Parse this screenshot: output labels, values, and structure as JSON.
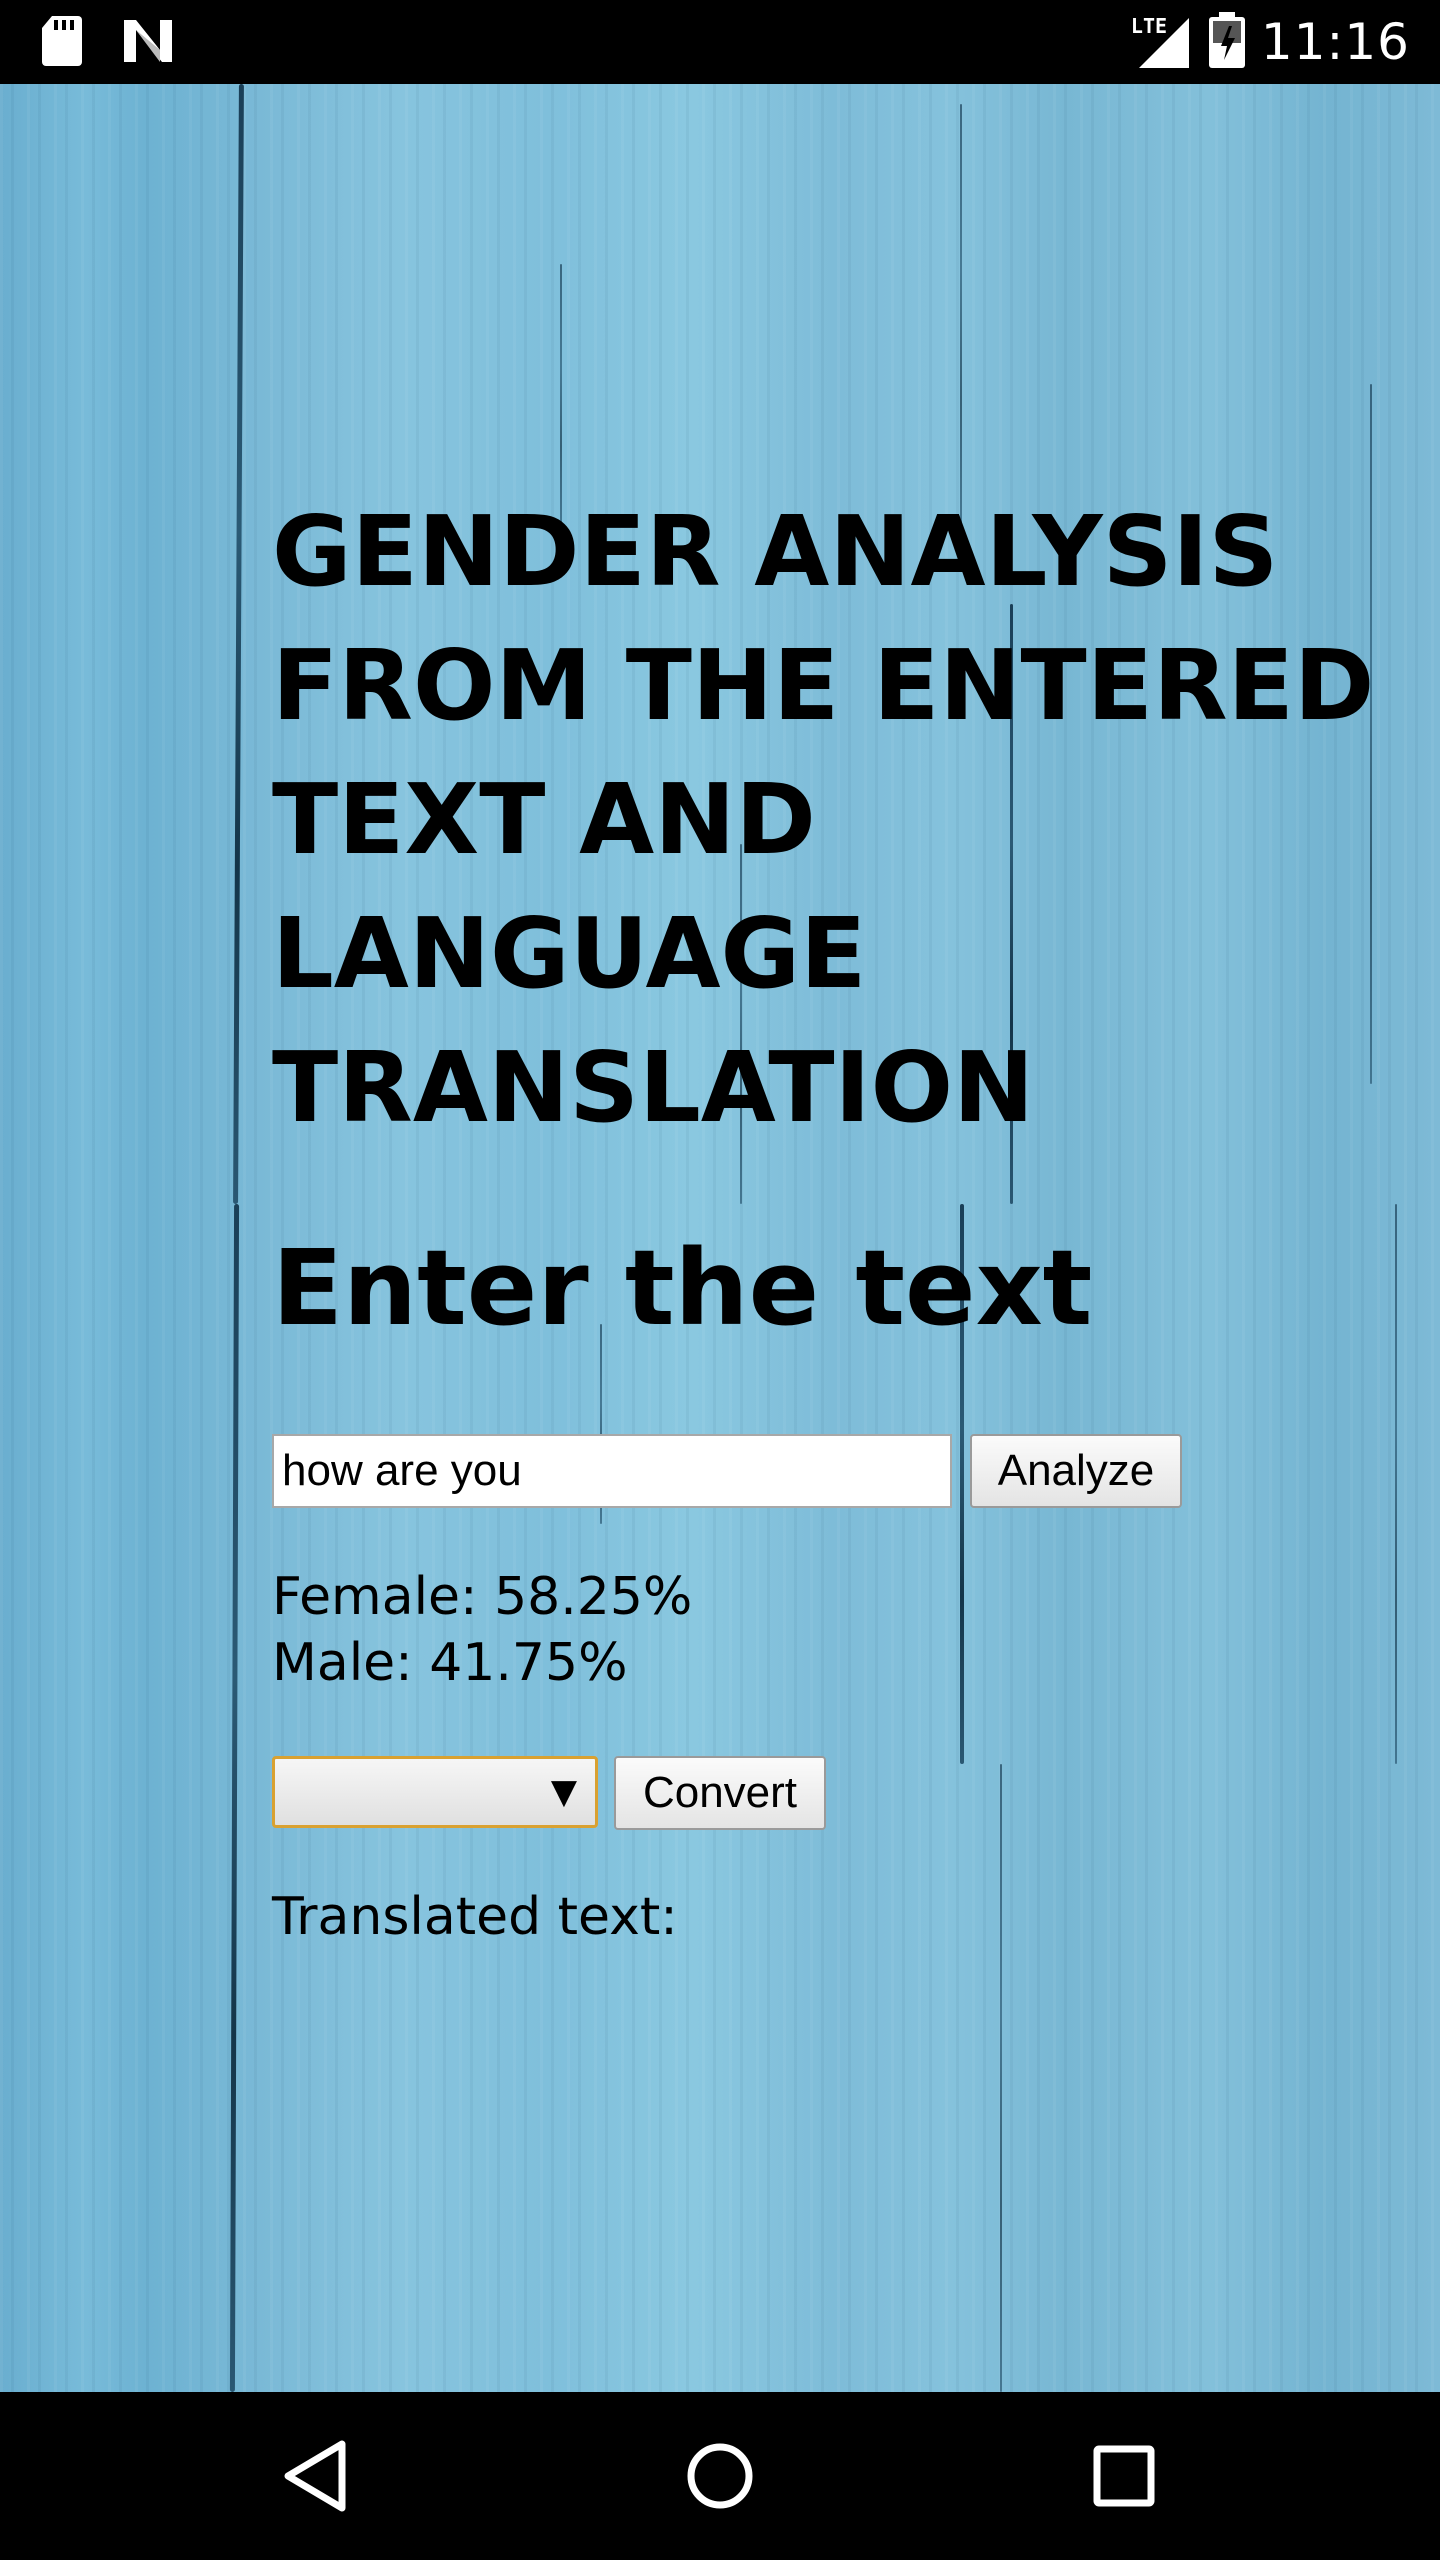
{
  "status_bar": {
    "time": "11:16",
    "network_label": "LTE",
    "left_icons": [
      "sd-card-icon",
      "n-logo-icon"
    ],
    "right_icons": [
      "signal-icon",
      "battery-icon"
    ]
  },
  "header": {
    "title": "GENDER ANALYSIS FROM THE ENTERED TEXT AND LANGUAGE TRANSLATION"
  },
  "form": {
    "heading": "Enter the text",
    "input_value": "how are you",
    "analyze_label": "Analyze",
    "results": {
      "female_text": "Female: 58.25%",
      "male_text": "Male: 41.75%"
    },
    "language_select_value": "",
    "select_arrow": "▼",
    "convert_label": "Convert",
    "translated_label": "Translated text:",
    "translated_value": ""
  },
  "nav_bar": {
    "buttons": [
      "back-icon",
      "home-icon",
      "recents-icon"
    ]
  },
  "colors": {
    "background": "#7fbfdb",
    "select_focus_border": "#d9a131",
    "bars": "#000000"
  }
}
